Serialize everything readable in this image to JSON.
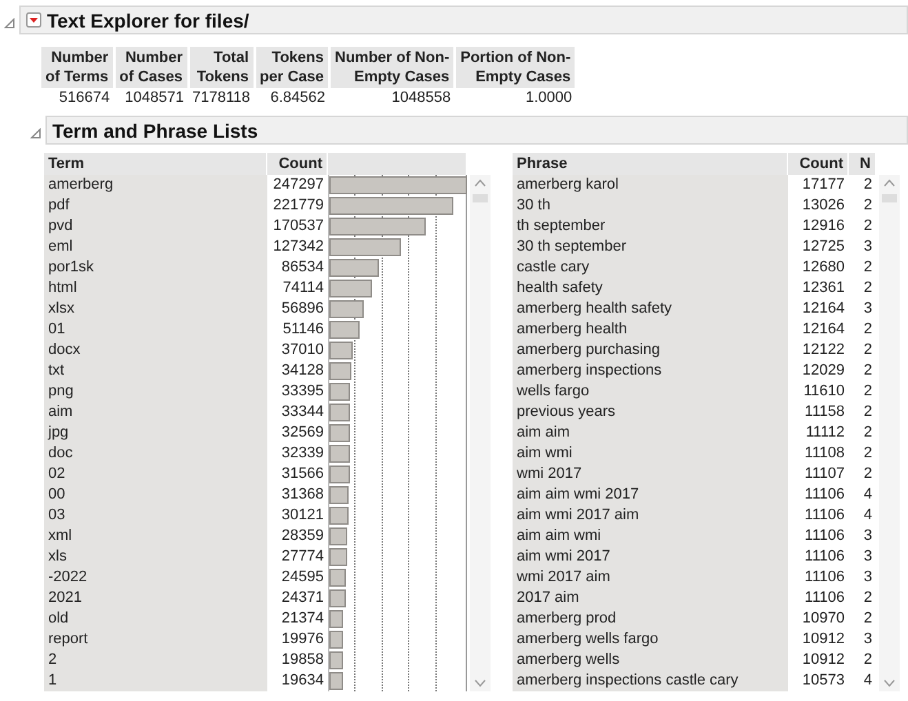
{
  "title": "Text Explorer for files/",
  "summary": {
    "columns": [
      [
        "Number",
        "of Terms"
      ],
      [
        "Number",
        "of Cases"
      ],
      [
        "Total",
        "Tokens"
      ],
      [
        "Tokens",
        "per Case"
      ],
      [
        "Number of Non-",
        "Empty Cases"
      ],
      [
        "Portion of Non-",
        "Empty Cases"
      ]
    ],
    "values": [
      "516674",
      "1048571",
      "7178118",
      "6.84562",
      "1048558",
      "1.0000"
    ]
  },
  "section_title": "Term and Phrase Lists",
  "terms": {
    "columns": [
      "Term",
      "Count"
    ],
    "rows": [
      {
        "term": "amerberg",
        "count": "247297",
        "level": 1
      },
      {
        "term": "pdf",
        "count": "221779",
        "level": 0.897
      },
      {
        "term": "pvd",
        "count": "170537",
        "level": 0.69
      },
      {
        "term": "eml",
        "count": "127342",
        "level": 0.515
      },
      {
        "term": "por1sk",
        "count": "86534",
        "level": 0.35
      },
      {
        "term": "html",
        "count": "74114",
        "level": 0.3
      },
      {
        "term": "xlsx",
        "count": "56896",
        "level": 0.23
      },
      {
        "term": "01",
        "count": "51146",
        "level": 0.207
      },
      {
        "term": "docx",
        "count": "37010",
        "level": 0.15
      },
      {
        "term": "txt",
        "count": "34128",
        "level": 0.138
      },
      {
        "term": "png",
        "count": "33395",
        "level": 0.135
      },
      {
        "term": "aim",
        "count": "33344",
        "level": 0.135
      },
      {
        "term": "jpg",
        "count": "32569",
        "level": 0.132
      },
      {
        "term": "doc",
        "count": "32339",
        "level": 0.131
      },
      {
        "term": "02",
        "count": "31566",
        "level": 0.128
      },
      {
        "term": "00",
        "count": "31368",
        "level": 0.127
      },
      {
        "term": "03",
        "count": "30121",
        "level": 0.122
      },
      {
        "term": "xml",
        "count": "28359",
        "level": 0.115
      },
      {
        "term": "xls",
        "count": "27774",
        "level": 0.112
      },
      {
        "term": "-2022",
        "count": "24595",
        "level": 0.099
      },
      {
        "term": "2021",
        "count": "24371",
        "level": 0.099
      },
      {
        "term": "old",
        "count": "21374",
        "level": 0.086
      },
      {
        "term": "report",
        "count": "19976",
        "level": 0.081
      },
      {
        "term": "2",
        "count": "19858",
        "level": 0.08
      },
      {
        "term": "1",
        "count": "19634",
        "level": 0.079
      }
    ]
  },
  "phrases": {
    "columns": [
      "Phrase",
      "Count",
      "N"
    ],
    "rows": [
      [
        "amerberg karol",
        "17177",
        "2"
      ],
      [
        "30 th",
        "13026",
        "2"
      ],
      [
        "th september",
        "12916",
        "2"
      ],
      [
        "30 th september",
        "12725",
        "3"
      ],
      [
        "castle cary",
        "12680",
        "2"
      ],
      [
        "health safety",
        "12361",
        "2"
      ],
      [
        "amerberg health safety",
        "12164",
        "3"
      ],
      [
        "amerberg health",
        "12164",
        "2"
      ],
      [
        "amerberg purchasing",
        "12122",
        "2"
      ],
      [
        "amerberg inspections",
        "12029",
        "2"
      ],
      [
        "wells fargo",
        "11610",
        "2"
      ],
      [
        "previous years",
        "11158",
        "2"
      ],
      [
        "aim aim",
        "11112",
        "2"
      ],
      [
        "aim wmi",
        "11108",
        "2"
      ],
      [
        "wmi 2017",
        "11107",
        "2"
      ],
      [
        "aim aim wmi 2017",
        "11106",
        "4"
      ],
      [
        "aim wmi 2017 aim",
        "11106",
        "4"
      ],
      [
        "aim aim wmi",
        "11106",
        "3"
      ],
      [
        "aim wmi 2017",
        "11106",
        "3"
      ],
      [
        "wmi 2017 aim",
        "11106",
        "3"
      ],
      [
        "2017 aim",
        "11106",
        "2"
      ],
      [
        "amerberg prod",
        "10970",
        "2"
      ],
      [
        "amerberg wells fargo",
        "10912",
        "3"
      ],
      [
        "amerberg wells",
        "10912",
        "2"
      ],
      [
        "amerberg inspections castle cary",
        "10573",
        "4"
      ]
    ]
  }
}
